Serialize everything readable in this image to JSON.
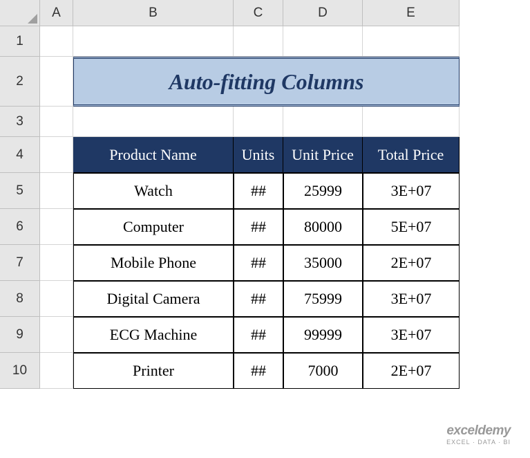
{
  "columns": [
    "A",
    "B",
    "C",
    "D",
    "E"
  ],
  "rows": [
    "1",
    "2",
    "3",
    "4",
    "5",
    "6",
    "7",
    "8",
    "9",
    "10"
  ],
  "title": "Auto-fitting Columns",
  "headers": {
    "b": "Product Name",
    "c": "Units",
    "d": "Unit Price",
    "e": "Total Price"
  },
  "data": [
    {
      "name": "Watch",
      "units": "##",
      "price": "25999",
      "total": "3E+07"
    },
    {
      "name": "Computer",
      "units": "##",
      "price": "80000",
      "total": "5E+07"
    },
    {
      "name": "Mobile Phone",
      "units": "##",
      "price": "35000",
      "total": "2E+07"
    },
    {
      "name": "Digital Camera",
      "units": "##",
      "price": "75999",
      "total": "3E+07"
    },
    {
      "name": "ECG Machine",
      "units": "##",
      "price": "99999",
      "total": "3E+07"
    },
    {
      "name": "Printer",
      "units": "##",
      "price": "7000",
      "total": "2E+07"
    }
  ],
  "watermark": {
    "brand": "exceldemy",
    "tagline": "EXCEL · DATA · BI"
  },
  "chart_data": {
    "type": "table",
    "title": "Auto-fitting Columns",
    "columns": [
      "Product Name",
      "Units",
      "Unit Price",
      "Total Price"
    ],
    "rows": [
      [
        "Watch",
        "##",
        25999,
        "3E+07"
      ],
      [
        "Computer",
        "##",
        80000,
        "5E+07"
      ],
      [
        "Mobile Phone",
        "##",
        35000,
        "2E+07"
      ],
      [
        "Digital Camera",
        "##",
        75999,
        "3E+07"
      ],
      [
        "ECG Machine",
        "##",
        99999,
        "3E+07"
      ],
      [
        "Printer",
        "##",
        7000,
        "2E+07"
      ]
    ]
  }
}
